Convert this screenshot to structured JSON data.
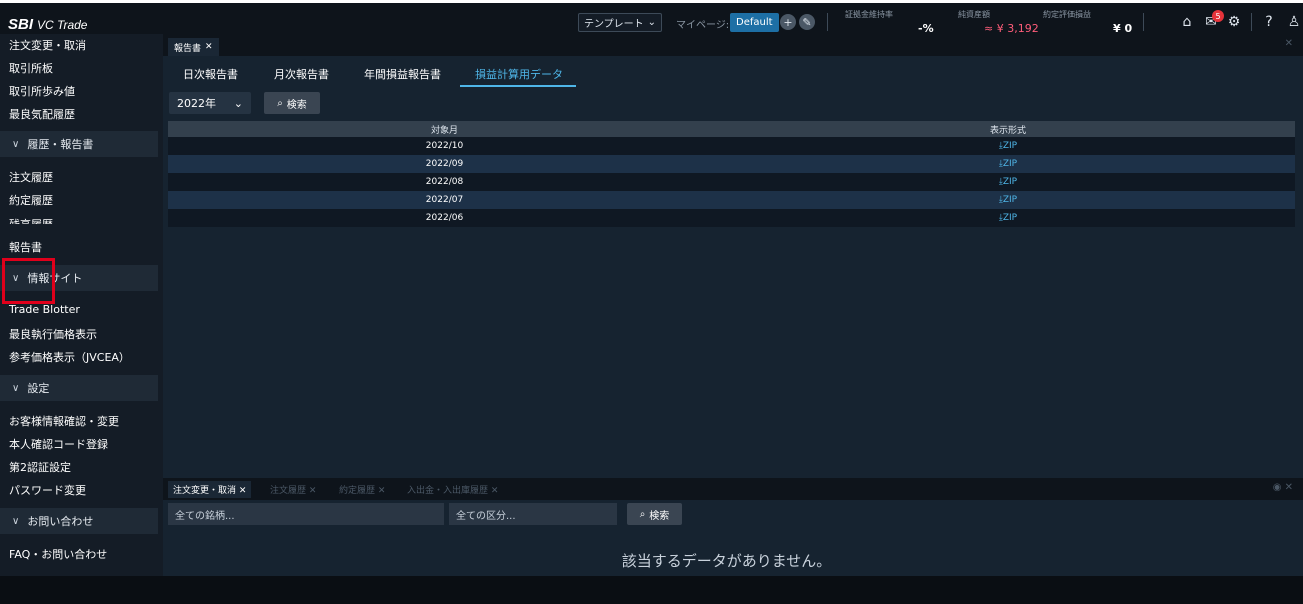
{
  "brand": {
    "sbi": "SBI",
    "vc": "VC Trade"
  },
  "header": {
    "template_label": "テンプレート",
    "mypage_label": "マイページ:",
    "default_label": "Default",
    "stats": [
      {
        "label": "証拠金維持率",
        "value": "-%"
      },
      {
        "label": "純資産額",
        "value": "≈ ¥ 3,192"
      },
      {
        "label": "約定評価損益",
        "value": "¥ 0"
      }
    ],
    "notification_count": "5"
  },
  "sidebar": {
    "top_items": [
      "注文変更・取消",
      "取引所板",
      "取引所歩み値",
      "最良気配履歴"
    ],
    "sections": [
      {
        "title": "履歴・報告書",
        "items": [
          "注文履歴",
          "約定履歴",
          "残高履歴",
          "報告書"
        ]
      },
      {
        "title": "情報サイト",
        "items": [
          "Trade Blotter",
          "最良執行価格表示",
          "参考価格表示（JVCEA）"
        ]
      },
      {
        "title": "設定",
        "items": [
          "お客様情報確認・変更",
          "本人確認コード登録",
          "第2認証設定",
          "パスワード変更"
        ]
      },
      {
        "title": "お問い合わせ",
        "items": [
          "FAQ・お問い合わせ"
        ]
      }
    ]
  },
  "main": {
    "panel_tab": "報告書",
    "subtabs": [
      "日次報告書",
      "月次報告書",
      "年間損益報告書",
      "損益計算用データ"
    ],
    "active_subtab": "損益計算用データ",
    "year_select": "2022年",
    "search_label": "検索",
    "table": {
      "headers": [
        "対象月",
        "表示形式"
      ],
      "rows": [
        {
          "month": "2022/10",
          "format": "ZIP"
        },
        {
          "month": "2022/09",
          "format": "ZIP"
        },
        {
          "month": "2022/08",
          "format": "ZIP"
        },
        {
          "month": "2022/07",
          "format": "ZIP"
        },
        {
          "month": "2022/06",
          "format": "ZIP"
        }
      ]
    }
  },
  "bottom": {
    "tabs": [
      "注文変更・取消",
      "注文履歴",
      "約定履歴",
      "入出金・入出庫履歴"
    ],
    "symbol_filter": "全ての銘柄...",
    "type_filter": "全ての区分...",
    "search_label": "検索",
    "empty_message": "該当するデータがありません。"
  },
  "colors": {
    "accent": "#4fb6e8",
    "highlight": "#e0001b",
    "badge": "#e5333a",
    "positive": "#ff5d7a"
  },
  "icons": [
    "home-icon",
    "mail-icon",
    "gear-icon",
    "help-icon",
    "user-icon",
    "logout-icon",
    "download-icon",
    "search-icon",
    "plus-icon",
    "edit-icon",
    "eye-icon"
  ]
}
